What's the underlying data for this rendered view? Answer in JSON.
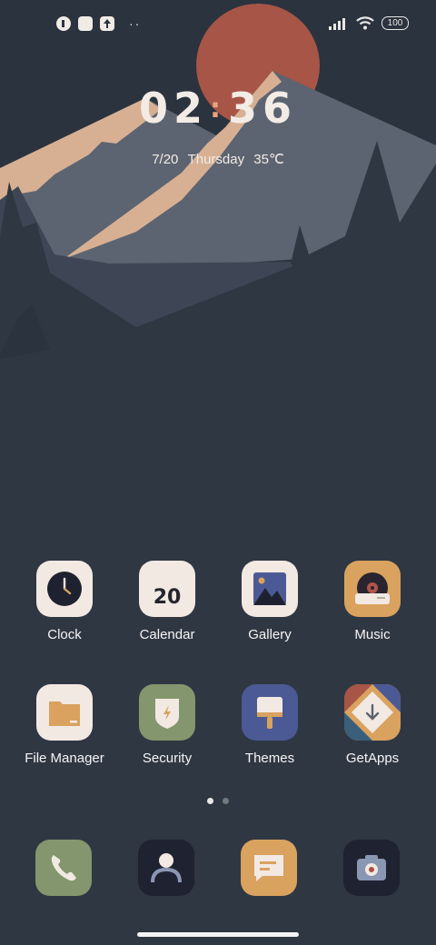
{
  "status_bar": {
    "notification_icons": [
      "chat-bubble-icon",
      "square-app-icon",
      "upload-icon"
    ],
    "overflow_dots": "··",
    "battery": "100"
  },
  "lockscreen": {
    "time_hours": "02",
    "time_minutes": "36",
    "date": "7/20",
    "weekday": "Thursday",
    "temperature": "35℃"
  },
  "apps": [
    {
      "label": "Clock",
      "icon": "clock-icon"
    },
    {
      "label": "Calendar",
      "icon": "calendar-icon",
      "day": "20"
    },
    {
      "label": "Gallery",
      "icon": "gallery-icon"
    },
    {
      "label": "Music",
      "icon": "music-icon"
    },
    {
      "label": "File Manager",
      "icon": "folder-icon"
    },
    {
      "label": "Security",
      "icon": "shield-icon"
    },
    {
      "label": "Themes",
      "icon": "paintbrush-icon"
    },
    {
      "label": "GetApps",
      "icon": "download-icon"
    }
  ],
  "pager": {
    "pages": 2,
    "current": 1
  },
  "dock": [
    {
      "icon": "phone-icon"
    },
    {
      "icon": "contacts-icon"
    },
    {
      "icon": "messages-icon"
    },
    {
      "icon": "camera-icon"
    }
  ],
  "colors": {
    "background": "#2b333e",
    "sun": "#a65546",
    "mountain_light": "#5d6471",
    "snow": "#d7b094",
    "icon_cream": "#f2e9e3",
    "accent_orange": "#d9a25f",
    "accent_green": "#84966d",
    "accent_blue": "#4b5a94"
  }
}
